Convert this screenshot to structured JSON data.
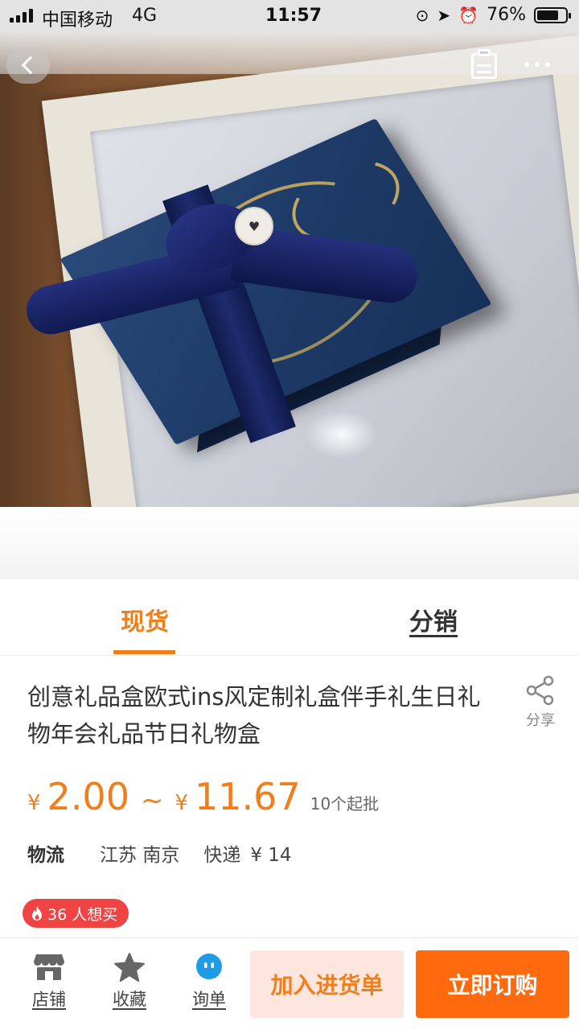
{
  "status_bar": {
    "carrier": "中国移动",
    "network": "4G",
    "time": "11:57",
    "battery_percent_text": "76%",
    "battery_level": 0.76,
    "icons": [
      "signal-icon",
      "orientation-lock-icon",
      "location-icon",
      "alarm-icon",
      "battery-icon"
    ]
  },
  "header": {
    "icons": [
      "back-icon",
      "clipboard-icon",
      "more-icon"
    ]
  },
  "hero": {
    "tag_glyph": "♥"
  },
  "tabs": {
    "active_label": "现货",
    "other_label": "分销",
    "accent_color": "#f07e1a"
  },
  "product": {
    "title": "创意礼品盒欧式ins风定制礼盒伴手礼生日礼物年会礼品节日礼物盒",
    "share_label": "分享",
    "currency": "¥",
    "price_min": "2.00",
    "price_separator": "~",
    "price_max": "11.67",
    "moq": "10个起批",
    "logistics_label": "物流",
    "origin": "江苏 南京",
    "shipping_method": "快递",
    "shipping_fee": "¥ 14",
    "hot_badge": "36 人想买",
    "price_color": "#f07e1a",
    "badge_color": "#f04343"
  },
  "bottom_bar": {
    "shop_label": "店铺",
    "favorite_label": "收藏",
    "inquiry_label": "询单",
    "add_to_cart_label": "加入进货单",
    "buy_now_label": "立即订购",
    "buy_color": "#ff6a0e"
  }
}
